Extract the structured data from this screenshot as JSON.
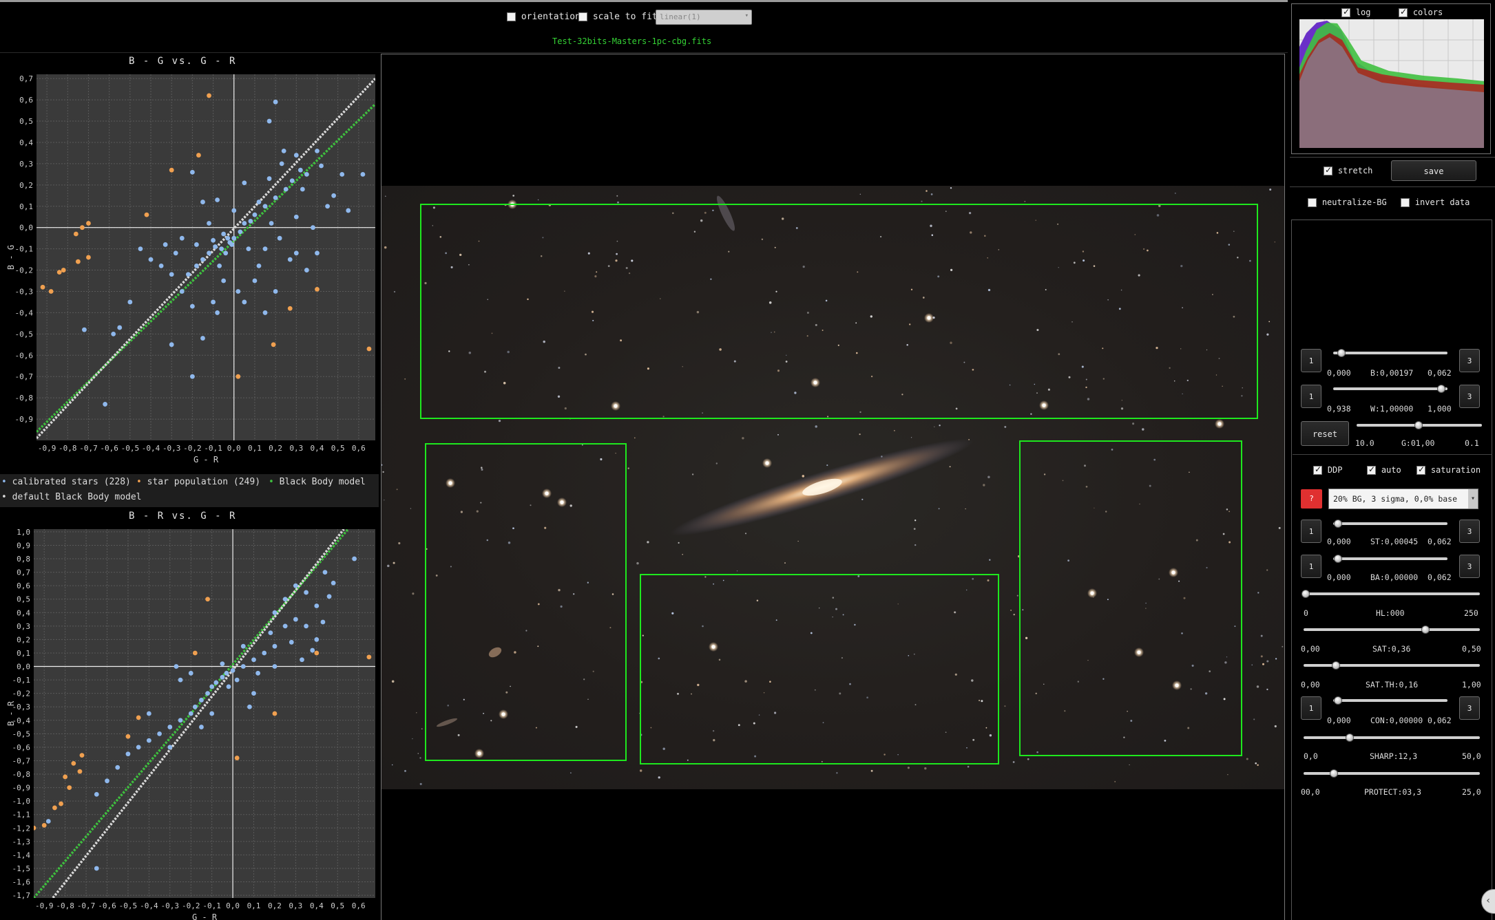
{
  "toolbar": {
    "orientation_label": "orientation",
    "orientation_checked": false,
    "scale_label": "scale to fit",
    "scale_checked": false,
    "stretch_mode": "linear(1)",
    "filename": "Test-32bits-Masters-1pc-cbg.fits"
  },
  "plot1": {
    "title": "B - G   vs.   G - R",
    "xlabel": "G - R",
    "ylabel": "B - G"
  },
  "plot2": {
    "title": "B - R   vs.   G - R",
    "xlabel": "G - R",
    "ylabel": "B - R"
  },
  "legend": {
    "calibrated": "calibrated stars (228)",
    "population": "star population (249)",
    "blackbody": "Black Body model",
    "default_bb": "default Black Body model"
  },
  "colors": {
    "calibrated": "#8fb8ec",
    "population": "#f0a050",
    "blackbody": "#3fbf3f",
    "default_bb": "#d8d8d8",
    "roi": "#1ee81e"
  },
  "chart_data": [
    {
      "type": "scatter",
      "title": "B - G   vs.   G - R",
      "xlabel": "G - R",
      "ylabel": "B - G",
      "xlim": [
        -0.95,
        0.68
      ],
      "ylim": [
        -1.0,
        0.72
      ],
      "xticks": [
        "-0,9",
        "-0,8",
        "-0,7",
        "-0,6",
        "-0,5",
        "-0,4",
        "-0,3",
        "-0,2",
        "-0,1",
        "0,0",
        "0,1",
        "0,2",
        "0,3",
        "0,4",
        "0,5",
        "0,6"
      ],
      "yticks": [
        "0,7",
        "0,6",
        "0,5",
        "0,4",
        "0,3",
        "0,2",
        "0,1",
        "0,0",
        "-0,1",
        "-0,2",
        "-0,3",
        "-0,4",
        "-0,5",
        "-0,6",
        "-0,7",
        "-0,8",
        "-0,9"
      ],
      "grid": true,
      "series": [
        {
          "name": "calibrated stars (228)",
          "points": [
            [
              0.2,
              0.59
            ],
            [
              0.17,
              0.5
            ],
            [
              0.24,
              0.36
            ],
            [
              0.3,
              0.34
            ],
            [
              0.05,
              0.21
            ],
            [
              -0.2,
              0.26
            ],
            [
              -0.08,
              0.13
            ],
            [
              0.12,
              0.12
            ],
            [
              -0.15,
              0.12
            ],
            [
              0.42,
              0.29
            ],
            [
              0.52,
              0.25
            ],
            [
              0.45,
              0.1
            ],
            [
              0.33,
              0.18
            ],
            [
              0.05,
              0.02
            ],
            [
              -0.05,
              -0.03
            ],
            [
              -0.03,
              -0.05
            ],
            [
              -0.02,
              -0.07
            ],
            [
              -0.01,
              -0.08
            ],
            [
              0.0,
              -0.05
            ],
            [
              -0.06,
              -0.1
            ],
            [
              -0.09,
              -0.09
            ],
            [
              -0.12,
              -0.12
            ],
            [
              -0.15,
              -0.15
            ],
            [
              -0.18,
              -0.18
            ],
            [
              -0.04,
              -0.12
            ],
            [
              -0.1,
              -0.06
            ],
            [
              0.03,
              -0.02
            ],
            [
              0.08,
              0.03
            ],
            [
              0.1,
              0.06
            ],
            [
              0.15,
              0.1
            ],
            [
              0.2,
              0.14
            ],
            [
              0.25,
              0.18
            ],
            [
              0.28,
              0.22
            ],
            [
              0.35,
              0.25
            ],
            [
              0.18,
              0.02
            ],
            [
              0.22,
              -0.05
            ],
            [
              0.3,
              -0.12
            ],
            [
              0.35,
              -0.2
            ],
            [
              0.4,
              -0.12
            ],
            [
              0.15,
              -0.1
            ],
            [
              0.1,
              -0.25
            ],
            [
              0.02,
              -0.3
            ],
            [
              -0.05,
              -0.25
            ],
            [
              -0.1,
              -0.35
            ],
            [
              -0.2,
              -0.37
            ],
            [
              -0.25,
              -0.3
            ],
            [
              -0.3,
              -0.22
            ],
            [
              -0.35,
              -0.18
            ],
            [
              -0.4,
              -0.15
            ],
            [
              -0.45,
              -0.1
            ],
            [
              -0.5,
              -0.35
            ],
            [
              -0.55,
              -0.47
            ],
            [
              -0.58,
              -0.5
            ],
            [
              -0.72,
              -0.48
            ],
            [
              -0.62,
              -0.83
            ],
            [
              -0.2,
              -0.7
            ],
            [
              -0.15,
              -0.52
            ],
            [
              0.15,
              -0.4
            ],
            [
              0.2,
              -0.3
            ],
            [
              0.05,
              -0.35
            ],
            [
              -0.3,
              -0.55
            ],
            [
              -0.08,
              -0.4
            ],
            [
              0.3,
              0.05
            ],
            [
              0.38,
              0.0
            ],
            [
              0.48,
              0.15
            ],
            [
              0.55,
              0.08
            ],
            [
              0.12,
              -0.18
            ],
            [
              0.27,
              -0.15
            ],
            [
              -0.25,
              -0.05
            ],
            [
              -0.33,
              -0.08
            ],
            [
              -0.22,
              -0.22
            ],
            [
              -0.12,
              0.02
            ],
            [
              0.0,
              0.08
            ],
            [
              0.07,
              -0.1
            ],
            [
              -0.07,
              -0.18
            ],
            [
              -0.18,
              -0.08
            ],
            [
              -0.28,
              -0.12
            ],
            [
              0.17,
              0.23
            ],
            [
              0.23,
              0.3
            ],
            [
              0.32,
              0.27
            ],
            [
              0.4,
              0.36
            ],
            [
              0.62,
              0.25
            ]
          ]
        },
        {
          "name": "star population (249)",
          "points": [
            [
              -0.12,
              0.62
            ],
            [
              -0.17,
              0.34
            ],
            [
              -0.3,
              0.27
            ],
            [
              -0.42,
              0.06
            ],
            [
              -0.73,
              0.0
            ],
            [
              -0.7,
              0.02
            ],
            [
              -0.76,
              -0.03
            ],
            [
              -0.75,
              -0.16
            ],
            [
              -0.7,
              -0.14
            ],
            [
              -0.82,
              -0.2
            ],
            [
              -0.84,
              -0.21
            ],
            [
              -0.88,
              -0.3
            ],
            [
              -0.92,
              -0.28
            ],
            [
              0.4,
              -0.29
            ],
            [
              0.27,
              -0.38
            ],
            [
              0.19,
              -0.55
            ],
            [
              0.02,
              -0.7
            ],
            [
              0.65,
              -0.57
            ]
          ]
        },
        {
          "name": "Black Body model",
          "line": [
            [
              -0.95,
              -0.96
            ],
            [
              0.68,
              0.58
            ]
          ]
        },
        {
          "name": "default Black Body model",
          "line": [
            [
              -0.95,
              -0.99
            ],
            [
              0.68,
              0.7
            ]
          ]
        }
      ]
    },
    {
      "type": "scatter",
      "title": "B - R   vs.   G - R",
      "xlabel": "G - R",
      "ylabel": "B - R",
      "xlim": [
        -0.95,
        0.68
      ],
      "ylim": [
        -1.72,
        1.02
      ],
      "xticks": [
        "-0,9",
        "-0,8",
        "-0,7",
        "-0,6",
        "-0,5",
        "-0,4",
        "-0,3",
        "-0,2",
        "-0,1",
        "0,0",
        "0,1",
        "0,2",
        "0,3",
        "0,4",
        "0,5",
        "0,6"
      ],
      "yticks": [
        "1,0",
        "0,9",
        "0,8",
        "0,7",
        "0,6",
        "0,5",
        "0,4",
        "0,3",
        "0,2",
        "0,1",
        "0,0",
        "-0,1",
        "-0,2",
        "-0,3",
        "-0,4",
        "-0,5",
        "-0,6",
        "-0,7",
        "-0,8",
        "-0,9",
        "-1,0",
        "-1,1",
        "-1,2",
        "-1,3",
        "-1,4",
        "-1,5",
        "-1,6",
        "-1,7"
      ],
      "grid": true,
      "series": [
        {
          "name": "calibrated stars (228)",
          "points": [
            [
              0.58,
              0.8
            ],
            [
              0.44,
              0.7
            ],
            [
              0.46,
              0.52
            ],
            [
              0.4,
              0.45
            ],
            [
              0.35,
              0.55
            ],
            [
              0.3,
              0.6
            ],
            [
              0.25,
              0.5
            ],
            [
              0.2,
              0.4
            ],
            [
              0.3,
              0.35
            ],
            [
              0.35,
              0.3
            ],
            [
              0.4,
              0.2
            ],
            [
              0.2,
              0.15
            ],
            [
              0.15,
              0.1
            ],
            [
              0.1,
              0.05
            ],
            [
              0.05,
              0.0
            ],
            [
              0.0,
              -0.03
            ],
            [
              -0.03,
              -0.05
            ],
            [
              -0.05,
              -0.08
            ],
            [
              -0.08,
              -0.12
            ],
            [
              -0.1,
              -0.15
            ],
            [
              -0.12,
              -0.2
            ],
            [
              -0.15,
              -0.25
            ],
            [
              -0.18,
              -0.3
            ],
            [
              -0.2,
              -0.35
            ],
            [
              -0.25,
              -0.4
            ],
            [
              -0.3,
              -0.45
            ],
            [
              -0.35,
              -0.5
            ],
            [
              -0.4,
              -0.55
            ],
            [
              -0.45,
              -0.6
            ],
            [
              -0.5,
              -0.65
            ],
            [
              -0.55,
              -0.75
            ],
            [
              -0.6,
              -0.85
            ],
            [
              -0.65,
              -0.95
            ],
            [
              -0.88,
              -1.15
            ],
            [
              -0.65,
              -1.5
            ],
            [
              -0.25,
              -0.1
            ],
            [
              -0.27,
              0.0
            ],
            [
              -0.2,
              -0.05
            ],
            [
              0.1,
              -0.2
            ],
            [
              0.08,
              -0.3
            ],
            [
              0.2,
              0.0
            ],
            [
              0.28,
              0.18
            ],
            [
              0.33,
              0.05
            ],
            [
              -0.02,
              -0.15
            ],
            [
              0.02,
              -0.1
            ],
            [
              0.12,
              -0.05
            ],
            [
              0.18,
              0.25
            ],
            [
              0.25,
              0.3
            ],
            [
              -0.15,
              -0.45
            ],
            [
              -0.1,
              -0.35
            ],
            [
              -0.4,
              -0.35
            ],
            [
              -0.3,
              -0.6
            ],
            [
              0.38,
              0.12
            ],
            [
              0.43,
              0.33
            ],
            [
              0.48,
              0.62
            ],
            [
              -0.05,
              0.02
            ],
            [
              0.05,
              0.15
            ]
          ]
        },
        {
          "name": "star population (249)",
          "points": [
            [
              -0.12,
              0.5
            ],
            [
              -0.18,
              0.1
            ],
            [
              -0.45,
              -0.38
            ],
            [
              -0.5,
              -0.52
            ],
            [
              -0.72,
              -0.66
            ],
            [
              -0.76,
              -0.72
            ],
            [
              -0.73,
              -0.78
            ],
            [
              -0.8,
              -0.82
            ],
            [
              -0.78,
              -0.9
            ],
            [
              -0.82,
              -1.02
            ],
            [
              -0.85,
              -1.05
            ],
            [
              -0.9,
              -1.18
            ],
            [
              -0.95,
              -1.2
            ],
            [
              0.4,
              0.1
            ],
            [
              0.2,
              -0.35
            ],
            [
              0.02,
              -0.68
            ],
            [
              0.65,
              0.07
            ]
          ]
        },
        {
          "name": "Black Body model",
          "line": [
            [
              -0.95,
              -1.72
            ],
            [
              0.55,
              1.02
            ]
          ]
        },
        {
          "name": "default Black Body model",
          "line": [
            [
              -0.95,
              -1.9
            ],
            [
              0.53,
              1.02
            ]
          ]
        }
      ]
    }
  ],
  "right": {
    "log_label": "log",
    "log_checked": true,
    "colors_label": "colors",
    "colors_checked": true,
    "stretch_label": "stretch",
    "stretch_checked": true,
    "save_label": "save",
    "neutralize_label": "neutralize-BG",
    "neutralize_checked": false,
    "invert_label": "invert data",
    "invert_checked": false,
    "b_min": "0,000",
    "b_value": "B:0,00197",
    "b_max": "0,062",
    "w_min": "0,938",
    "w_value": "W:1,00000",
    "w_max": "1,000",
    "reset_label": "reset",
    "g_min": "10.0",
    "g_value": "G:01,00",
    "g_max": "0.1",
    "ddp_label": "DDP",
    "ddp_checked": true,
    "auto_label": "auto",
    "auto_checked": true,
    "saturation_label": "saturation",
    "saturation_checked": true,
    "help_label": "?",
    "preset": "20% BG, 3 sigma, 0,0% base",
    "st_min": "0,000",
    "st_value": "ST:0,00045",
    "st_max": "0,062",
    "ba_min": "0,000",
    "ba_value": "BA:0,00000",
    "ba_max": "0,062",
    "hl_min": "0",
    "hl_value": "HL:000",
    "hl_max": "250",
    "sat_min": "0,00",
    "sat_value": "SAT:0,36",
    "sat_max": "0,50",
    "satth_min": "0,00",
    "satth_value": "SAT.TH:0,16",
    "satth_max": "1,00",
    "con_min": "0,000",
    "con_value": "CON:0,00000",
    "con_max": "0,062",
    "sharp_min": "0,0",
    "sharp_value": "SHARP:12,3",
    "sharp_max": "50,0",
    "protect_min": "00,0",
    "protect_value": "PROTECT:03,3",
    "protect_max": "25,0",
    "btn_one": "1",
    "btn_three": "3"
  }
}
